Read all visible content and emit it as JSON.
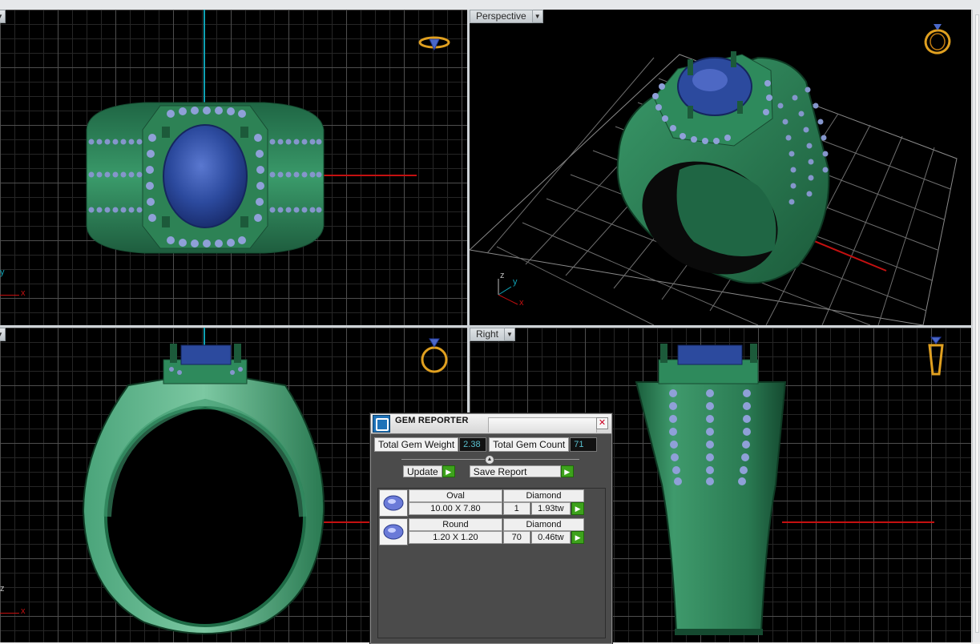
{
  "viewports": {
    "top": {
      "label": "",
      "dropdown_glyph": "▼"
    },
    "perspective": {
      "label": "Perspective",
      "dropdown_glyph": "▼"
    },
    "front": {
      "label": "",
      "dropdown_glyph": "▼"
    },
    "right": {
      "label": "Right",
      "dropdown_glyph": "▼"
    }
  },
  "axes": {
    "x": "x",
    "y": "y",
    "z": "z"
  },
  "gem_reporter": {
    "title": "GEM REPORTER",
    "close_glyph": "✕",
    "total_weight_label": "Total Gem Weight",
    "total_weight_value": "2.38",
    "total_count_label": "Total Gem Count",
    "total_count_value": "71",
    "update_label": "Update",
    "save_report_label": "Save Report",
    "go_glyph": "▶",
    "gems": [
      {
        "shape": "Oval",
        "material": "Diamond",
        "size": "10.00 X 7.80",
        "count": "1",
        "weight": "1.93tw"
      },
      {
        "shape": "Round",
        "material": "Diamond",
        "size": "1.20 X 1.20",
        "count": "70",
        "weight": "0.46tw"
      }
    ]
  },
  "colors": {
    "ring_metal": "#2e8a5c",
    "gem_center": "#2f4fa8",
    "side_stones": "#8fa0d8",
    "axis_red": "#c41010",
    "axis_cyan": "#0fa1b3",
    "nav_icon": "#e0a020"
  }
}
